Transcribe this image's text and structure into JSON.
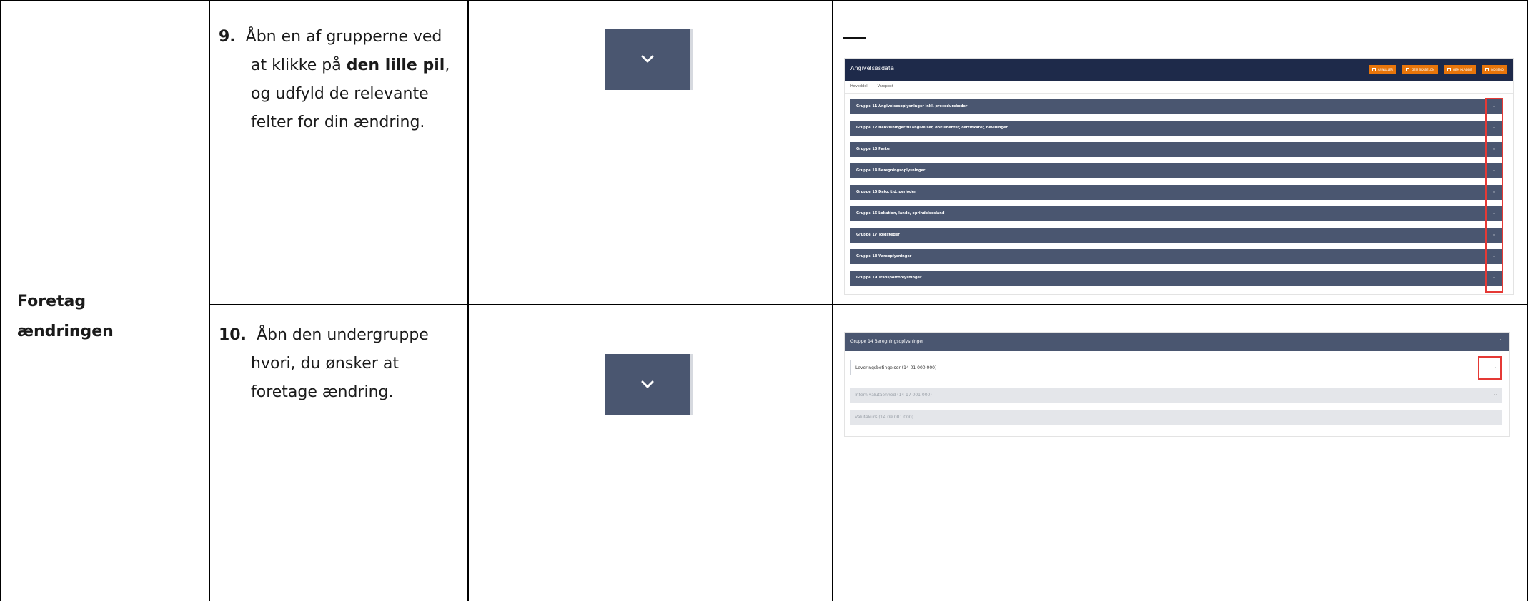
{
  "row_label": {
    "line1": "Foretag",
    "line2": "ændringen"
  },
  "step9": {
    "number": "9.",
    "line1": "Åbn en af grupperne ved",
    "line2_prefix": "at klikke på ",
    "line2_bold": "den lille pil",
    "line2_suffix": ",",
    "line3": "og udfyld de relevante",
    "line4": "felter for din ændring."
  },
  "step10": {
    "number": "10.",
    "line1": "Åbn den undergruppe",
    "line2": "hvori, du ønsker at",
    "line3": "foretage ændring."
  },
  "icons": {
    "step9_button": "chevron-down-icon",
    "step10_button": "chevron-down-icon"
  },
  "screenshot1": {
    "title": "Angivelsesdata",
    "actions": [
      {
        "label": "ANNULLER",
        "icon": "x-icon"
      },
      {
        "label": "GEM SKABELON",
        "icon": "save-icon"
      },
      {
        "label": "GEM KLADDE",
        "icon": "save-icon"
      },
      {
        "label": "INDSEND",
        "icon": "send-icon"
      }
    ],
    "tabs": [
      "Hoveddel",
      "Varepost"
    ],
    "groups": [
      "Gruppe 11 Angivelsesoplysninger inkl. procedurekoder",
      "Gruppe 12 Henvisninger til angivelser, dokumenter, certifikater, bevillinger",
      "Gruppe 13 Parter",
      "Gruppe 14 Beregningsoplysninger",
      "Gruppe 15 Dato, tid, perioder",
      "Gruppe 16 Lokation, lande, oprindelsesland",
      "Gruppe 17 Toldsteder",
      "Gruppe 18 Vareoplysninger",
      "Gruppe 19 Transportoplysninger"
    ],
    "accent_color": "#e8750a",
    "header_color": "#1e2a4a",
    "group_color": "#4a5670",
    "highlight_color": "#e53935"
  },
  "screenshot2": {
    "header": "Gruppe 14 Beregningsoplysninger",
    "fields": [
      {
        "label": "Leveringsbetingelser (14 01 000 000)",
        "state": "active"
      },
      {
        "label": "Intern valutaenhed (14 17 001 000)",
        "state": "disabled"
      },
      {
        "label": "Valutakurs (14 09 001 000)",
        "state": "disabled"
      }
    ]
  }
}
